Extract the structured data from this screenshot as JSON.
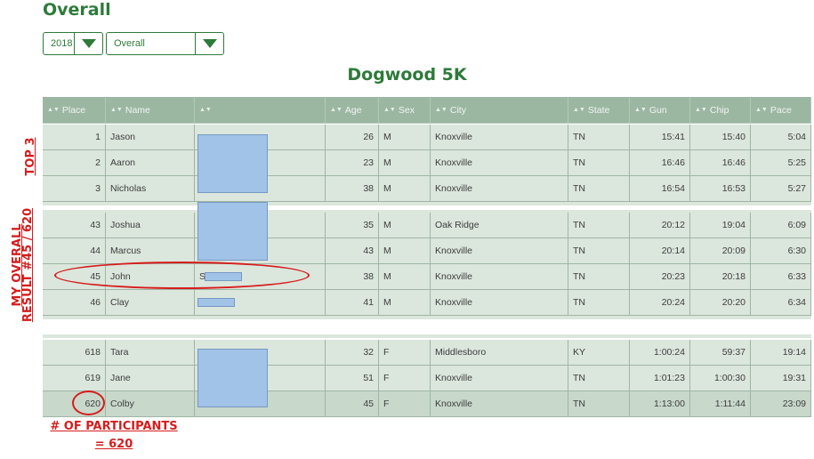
{
  "page": {
    "title": "Overall"
  },
  "filters": {
    "year": "2018",
    "category": "Overall"
  },
  "race": {
    "title": "Dogwood 5K"
  },
  "table": {
    "headers": [
      "Place",
      "Name",
      "",
      "Age",
      "Sex",
      "City",
      "State",
      "Gun",
      "Chip",
      "Pace"
    ],
    "rows": [
      {
        "place": "1",
        "name": "Jason",
        "age": "26",
        "sex": "M",
        "city": "Knoxville",
        "state": "TN",
        "gun": "15:41",
        "chip": "15:40",
        "pace": "5:04"
      },
      {
        "place": "2",
        "name": "Aaron",
        "age": "23",
        "sex": "M",
        "city": "Knoxville",
        "state": "TN",
        "gun": "16:46",
        "chip": "16:46",
        "pace": "5:25"
      },
      {
        "place": "3",
        "name": "Nicholas",
        "age": "38",
        "sex": "M",
        "city": "Knoxville",
        "state": "TN",
        "gun": "16:54",
        "chip": "16:53",
        "pace": "5:27"
      },
      {
        "place": "43",
        "name": "Joshua",
        "age": "35",
        "sex": "M",
        "city": "Oak Ridge",
        "state": "TN",
        "gun": "20:12",
        "chip": "19:04",
        "pace": "6:09"
      },
      {
        "place": "44",
        "name": "Marcus",
        "age": "43",
        "sex": "M",
        "city": "Knoxville",
        "state": "TN",
        "gun": "20:14",
        "chip": "20:09",
        "pace": "6:30"
      },
      {
        "place": "45",
        "name": "John",
        "col3": "S",
        "age": "38",
        "sex": "M",
        "city": "Knoxville",
        "state": "TN",
        "gun": "20:23",
        "chip": "20:18",
        "pace": "6:33"
      },
      {
        "place": "46",
        "name": "Clay",
        "age": "41",
        "sex": "M",
        "city": "Knoxville",
        "state": "TN",
        "gun": "20:24",
        "chip": "20:20",
        "pace": "6:34"
      },
      {
        "place": "618",
        "name": "Tara",
        "age": "32",
        "sex": "F",
        "city": "Middlesboro",
        "state": "KY",
        "gun": "1:00:24",
        "chip": "59:37",
        "pace": "19:14"
      },
      {
        "place": "619",
        "name": "Jane",
        "age": "51",
        "sex": "F",
        "city": "Knoxville",
        "state": "TN",
        "gun": "1:01:23",
        "chip": "1:00:30",
        "pace": "19:31"
      },
      {
        "place": "620",
        "name": "Colby",
        "age": "45",
        "sex": "F",
        "city": "Knoxville",
        "state": "TN",
        "gun": "1:13:00",
        "chip": "1:11:44",
        "pace": "23:09"
      }
    ]
  },
  "annotations": {
    "top3": "TOP 3",
    "my_result_line1": "MY OVERALL",
    "my_result_line2": "RESULT #45 / 620",
    "participants_line1": "# OF PARTICIPANTS",
    "participants_line2": "= 620"
  },
  "colors": {
    "brand": "#2e7a3a",
    "annotation": "#d61c1c",
    "redaction": "#a2c3e8"
  },
  "icons": {
    "dropdown": "chevron-down-icon",
    "sort": "sort-icon"
  }
}
